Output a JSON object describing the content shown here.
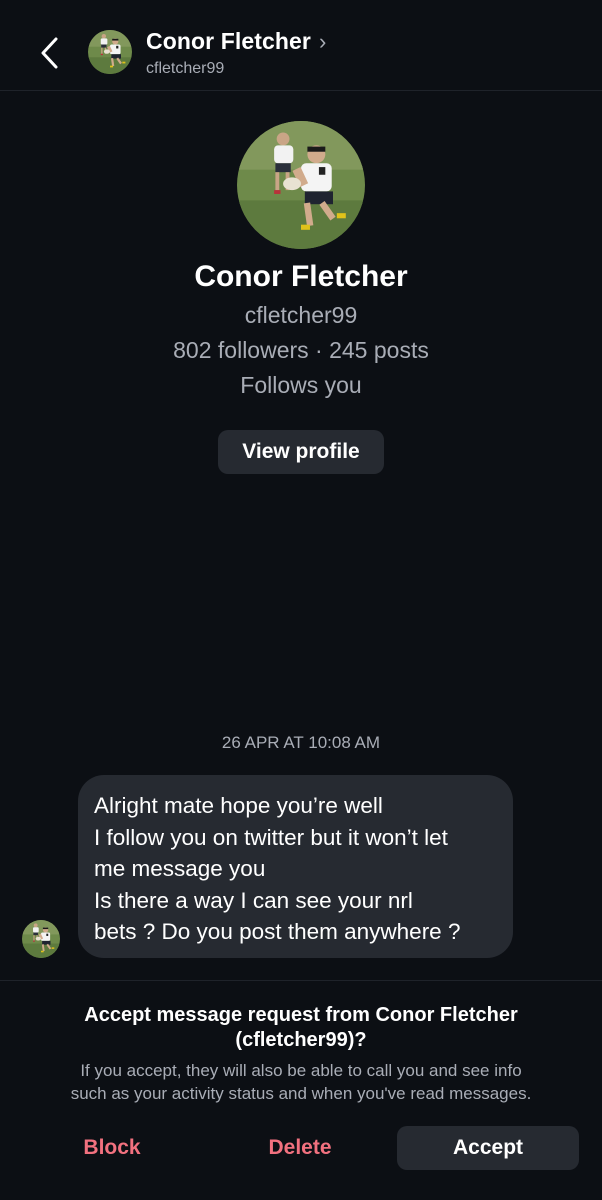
{
  "header": {
    "name": "Conor Fletcher",
    "chevron": "›",
    "username": "cfletcher99",
    "back_icon": "chevron-left-icon"
  },
  "profile": {
    "name": "Conor Fletcher",
    "username": "cfletcher99",
    "stats": "802 followers · 245 posts",
    "relationship": "Follows you",
    "view_profile_label": "View profile"
  },
  "conversation": {
    "timestamp": "26 APR AT 10:08 AM",
    "message_lines": [
      "Alright mate hope you’re well",
      "I follow you on twitter but it won’t let",
      "me message you",
      "Is there a way I can see your nrl",
      "bets ? Do you post them anywhere ?"
    ]
  },
  "request": {
    "title_line1": "Accept message request from Conor Fletcher",
    "title_line2": "(cfletcher99)?",
    "desc_line1": "If you accept, they will also be able to call you and see info",
    "desc_line2": "such as your activity status and when you've read messages.",
    "block_label": "Block",
    "delete_label": "Delete",
    "accept_label": "Accept"
  },
  "colors": {
    "background": "#0c0f14",
    "surface": "#262a31",
    "muted_text": "#a9adb6",
    "destructive": "#f2717f"
  }
}
